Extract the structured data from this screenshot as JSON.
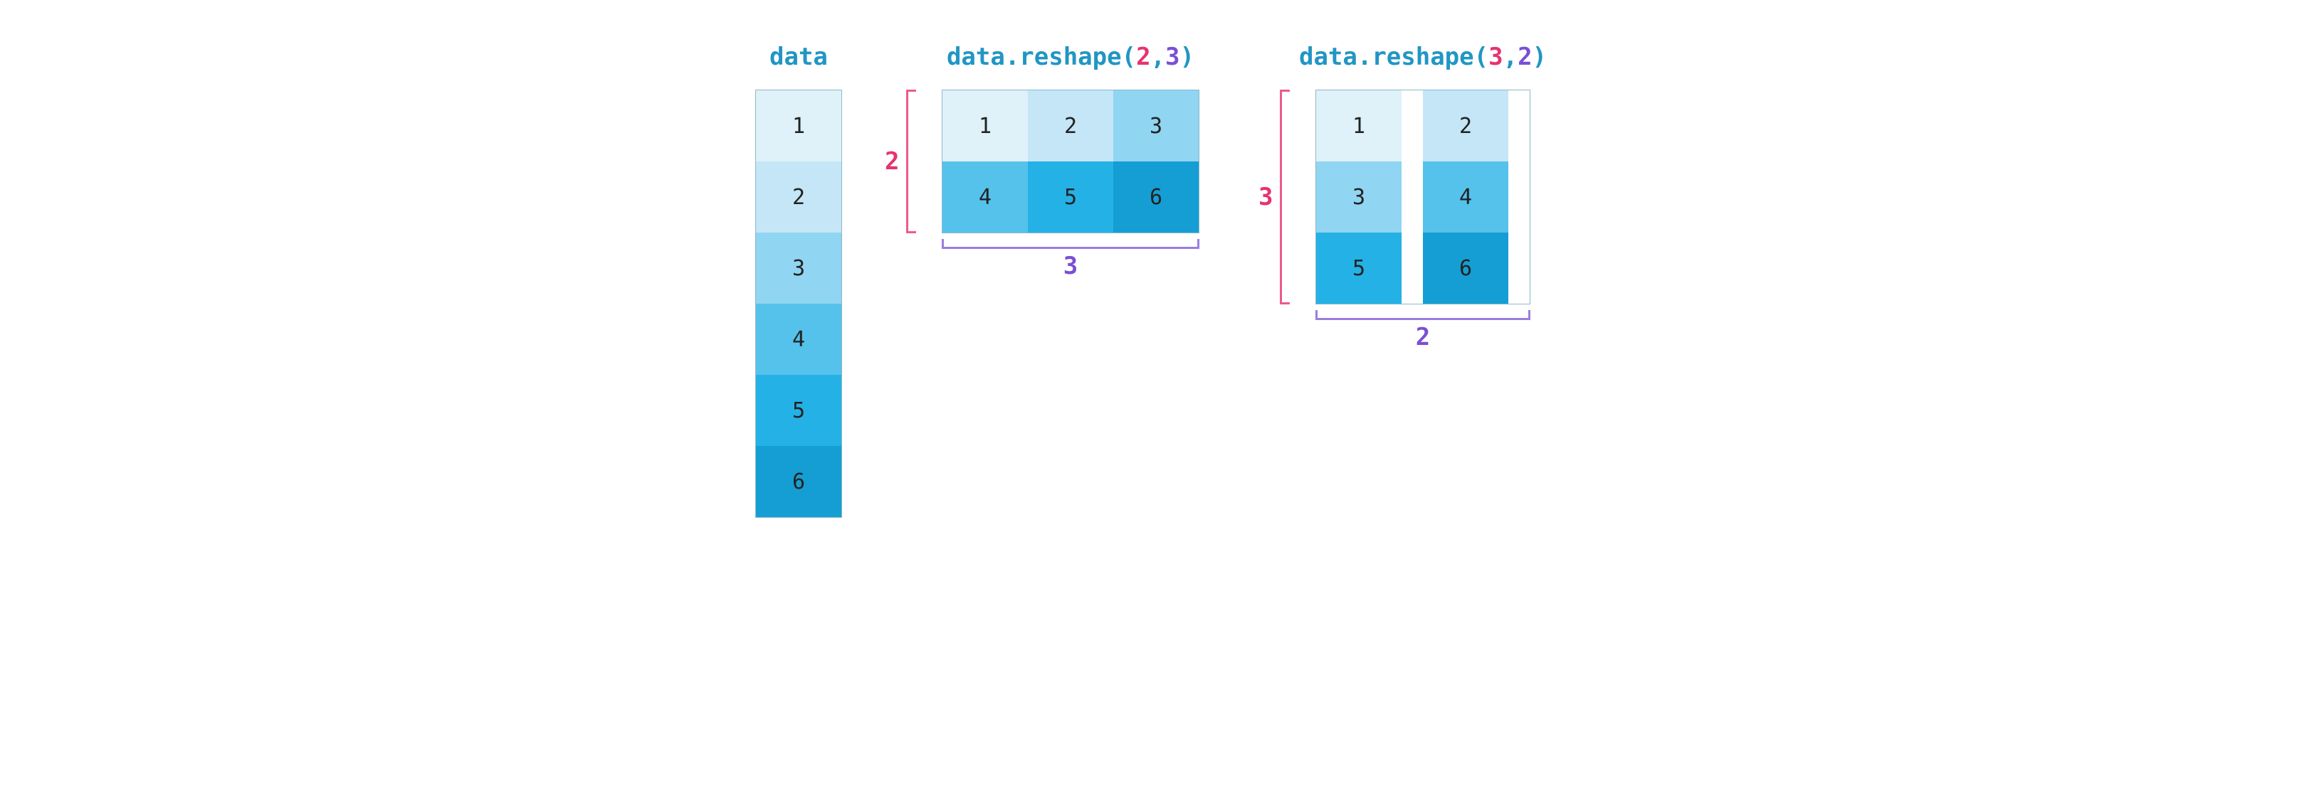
{
  "panels": {
    "p1": {
      "title_main": "data",
      "cells": [
        "1",
        "2",
        "3",
        "4",
        "5",
        "6"
      ]
    },
    "p2": {
      "title_main": "data.reshape",
      "paren_open": "(",
      "arg1": "2",
      "comma": ",",
      "arg2": "3",
      "paren_close": ")",
      "rows_label": "2",
      "cols_label": "3",
      "cells": [
        "1",
        "2",
        "3",
        "4",
        "5",
        "6"
      ]
    },
    "p3": {
      "title_main": "data.reshape",
      "paren_open": "(",
      "arg1": "3",
      "comma": ",",
      "arg2": "2",
      "paren_close": ")",
      "rows_label": "3",
      "cols_label": "2",
      "cells": [
        "1",
        "2",
        "3",
        "4",
        "5",
        "6"
      ]
    }
  }
}
